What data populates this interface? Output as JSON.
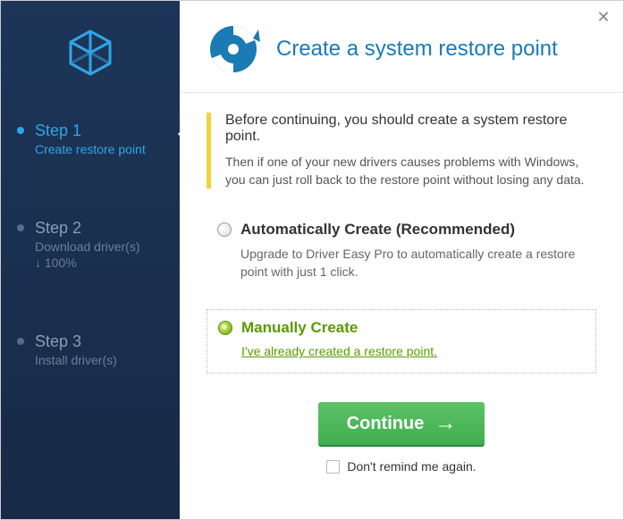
{
  "sidebar": {
    "steps": [
      {
        "title": "Step 1",
        "sub": "Create restore point",
        "active": true
      },
      {
        "title": "Step 2",
        "sub": "Download driver(s)",
        "extra": "↓ 100%",
        "active": false
      },
      {
        "title": "Step 3",
        "sub": "Install driver(s)",
        "active": false
      }
    ]
  },
  "header": {
    "title": "Create a system restore point"
  },
  "info": {
    "lead": "Before continuing, you should create a system restore point.",
    "body": "Then if one of your new drivers causes problems with Windows, you can just roll back to the restore point without losing any data."
  },
  "options": {
    "auto": {
      "title": "Automatically Create (Recommended)",
      "desc": "Upgrade to Driver Easy Pro to automatically create a restore point with just 1 click."
    },
    "manual": {
      "title": "Manually Create",
      "link": "I've already created a restore point."
    }
  },
  "footer": {
    "continue": "Continue",
    "remind": "Don't remind me again."
  },
  "colors": {
    "accent_blue": "#2fa6e6",
    "header_text": "#1a7bb5",
    "sidebar_bg": "#1d3558",
    "green": "#5a9a00",
    "button_green": "#4cb85c",
    "info_bar": "#f5d13b"
  }
}
